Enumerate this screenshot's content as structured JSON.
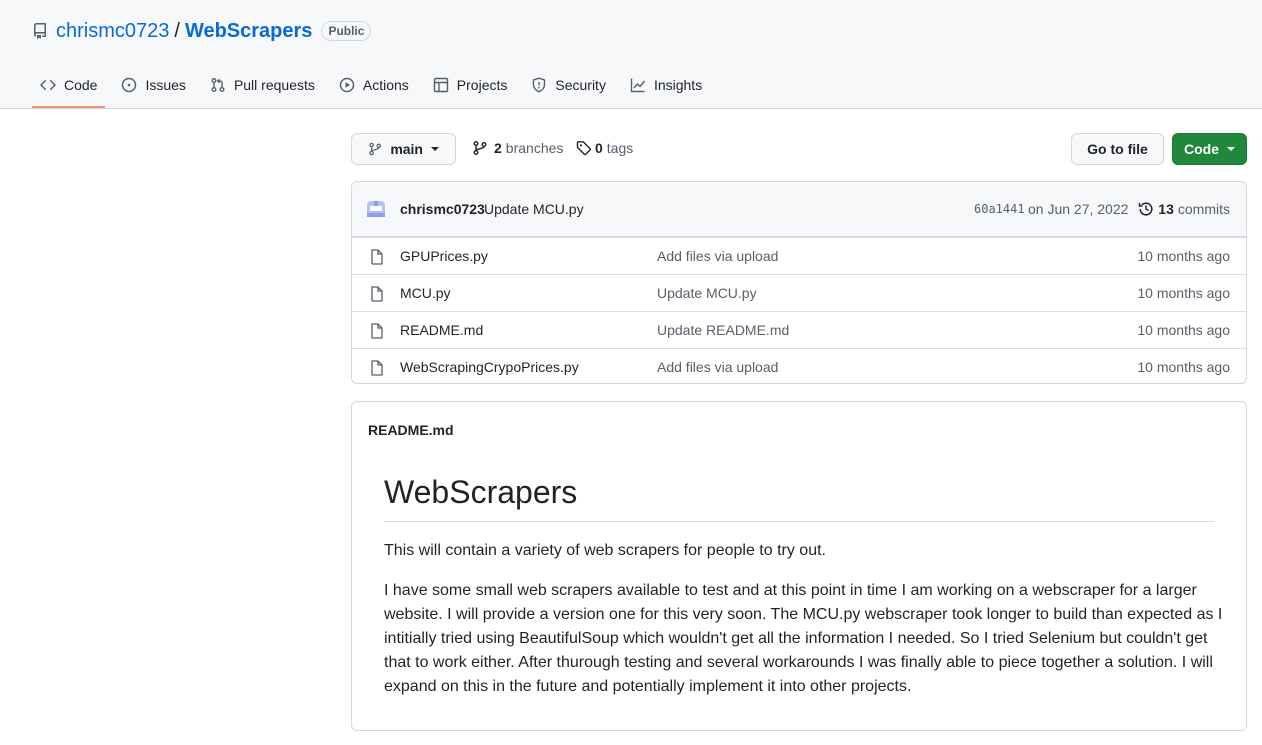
{
  "repo": {
    "owner": "chrismc0723",
    "separator": "/",
    "name": "WebScrapers",
    "visibility": "Public"
  },
  "tabs": [
    {
      "label": "Code",
      "icon": "code-icon",
      "active": true
    },
    {
      "label": "Issues",
      "icon": "issue-icon"
    },
    {
      "label": "Pull requests",
      "icon": "pull-request-icon"
    },
    {
      "label": "Actions",
      "icon": "play-icon"
    },
    {
      "label": "Projects",
      "icon": "table-icon"
    },
    {
      "label": "Security",
      "icon": "shield-icon"
    },
    {
      "label": "Insights",
      "icon": "graph-icon"
    }
  ],
  "toolbar": {
    "branch": "main",
    "branches_count": "2",
    "branches_label": "branches",
    "tags_count": "0",
    "tags_label": "tags",
    "go_to_file": "Go to file",
    "code_button": "Code"
  },
  "commit": {
    "author": "chrismc0723",
    "message": "Update MCU.py",
    "sha": "60a1441",
    "date": "on Jun 27, 2022",
    "count": "13",
    "count_label": "commits"
  },
  "files": [
    {
      "name": "GPUPrices.py",
      "message": "Add files via upload",
      "age": "10 months ago"
    },
    {
      "name": "MCU.py",
      "message": "Update MCU.py",
      "age": "10 months ago"
    },
    {
      "name": "README.md",
      "message": "Update README.md",
      "age": "10 months ago"
    },
    {
      "name": "WebScrapingCrypoPrices.py",
      "message": "Add files via upload",
      "age": "10 months ago"
    }
  ],
  "readme": {
    "filename": "README.md",
    "title": "WebScrapers",
    "p1": "This will contain a variety of web scrapers for people to try out.",
    "p2": "I have some small web scrapers available to test and at this point in time I am working on a webscraper for a larger website. I will provide a version one for this very soon. The MCU.py webscraper took longer to build than expected as I intitially tried using BeautifulSoup which wouldn't get all the information I needed. So I tried Selenium but couldn't get that to work either. After thurough testing and several workarounds I was finally able to piece together a solution. I will expand on this in the future and potentially implement it into other projects."
  },
  "colors": {
    "link": "#0969da",
    "primary_button": "#1f883d",
    "tab_underline": "#fd8c73",
    "muted": "#57606a"
  }
}
